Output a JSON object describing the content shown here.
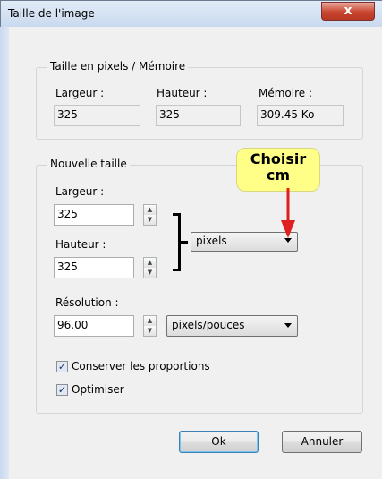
{
  "window": {
    "title": "Taille de l'image",
    "close_glyph": "x"
  },
  "pixels_memory": {
    "legend": "Taille en pixels / Mémoire",
    "width_label": "Largeur :",
    "width_value": "325",
    "height_label": "Hauteur :",
    "height_value": "325",
    "memory_label": "Mémoire :",
    "memory_value": "309.45 Ko"
  },
  "new_size": {
    "legend": "Nouvelle taille",
    "width_label": "Largeur :",
    "width_value": "325",
    "height_label": "Hauteur :",
    "height_value": "325",
    "unit_selected": "pixels",
    "resolution_label": "Résolution :",
    "resolution_value": "96.00",
    "resolution_unit_selected": "pixels/pouces"
  },
  "options": {
    "keep_proportions": {
      "label": "Conserver les proportions",
      "checked": true
    },
    "optimize": {
      "label": "Optimiser",
      "checked": true
    }
  },
  "buttons": {
    "ok": "Ok",
    "cancel": "Annuler"
  },
  "annotation": {
    "line1": "Choisir",
    "line2": "cm",
    "arrow_color": "#e02020"
  },
  "icons": {
    "spin_up": "▲",
    "spin_down": "▼",
    "check": "✓"
  }
}
